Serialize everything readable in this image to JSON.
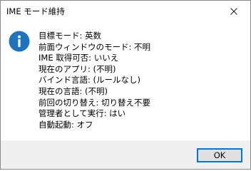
{
  "window": {
    "title": "IME モード維持",
    "close_icon": "close-icon"
  },
  "dialog": {
    "icon": "info-icon",
    "accent_color": "#1e73be",
    "lines": [
      "目標モード: 英数",
      "前面ウィンドウのモード: 不明",
      "IME 取得可否: いいえ",
      "現在のアプリ: (不明)",
      "バインド言語: (ルールなし)",
      "現在の言語: (不明)",
      "前回の切り替え: 切り替え不要",
      "管理者として実行: はい",
      "自動起動: オフ"
    ]
  },
  "footer": {
    "ok_label": "OK"
  }
}
